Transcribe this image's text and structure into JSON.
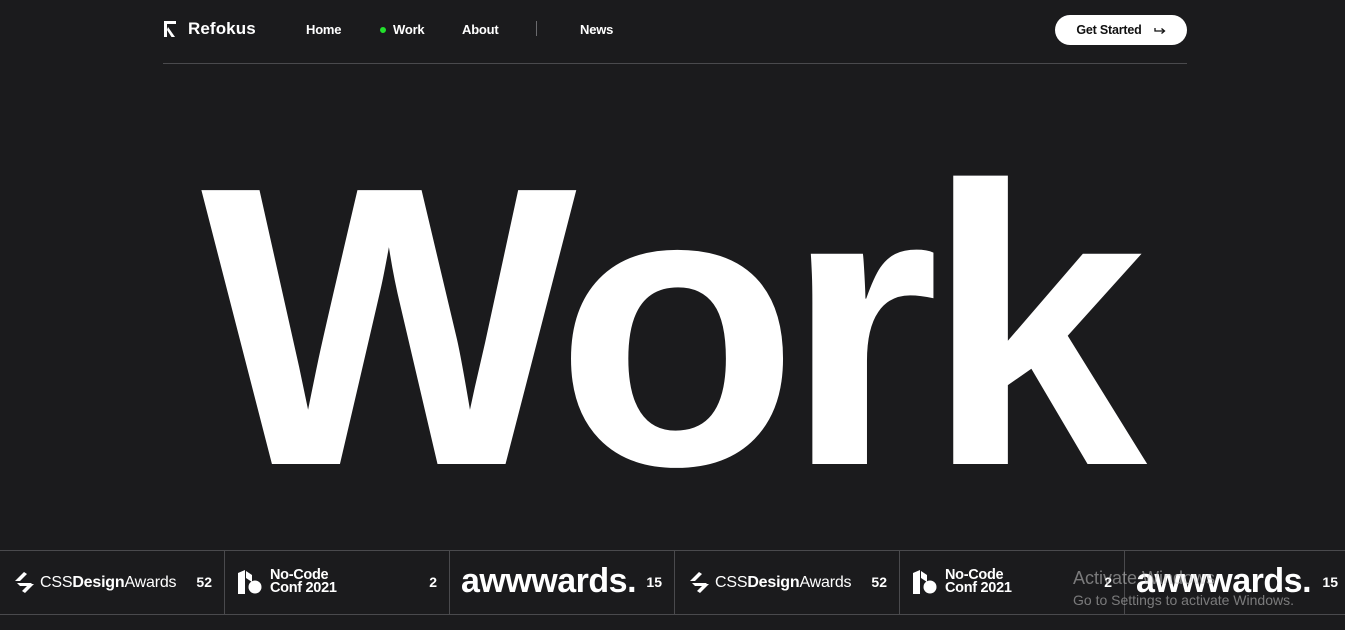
{
  "brand": {
    "name": "Refokus",
    "logo_icon": "refokus-logo-icon"
  },
  "nav": {
    "home": "Home",
    "work": "Work",
    "about": "About",
    "news": "News",
    "active_color": "#22e02c"
  },
  "cta": {
    "label": "Get Started",
    "icon": "arrow-right-icon"
  },
  "hero": {
    "title": "Work"
  },
  "awards": [
    {
      "type": "css",
      "pre": "CSS",
      "bold": "Design",
      "post": "Awards",
      "count": "52"
    },
    {
      "type": "nocode",
      "line1": "No-Code",
      "line2": "Conf 2021",
      "count": "2"
    },
    {
      "type": "awwwards",
      "label": "awwwards.",
      "count": "15"
    },
    {
      "type": "css",
      "pre": "CSS",
      "bold": "Design",
      "post": "Awards",
      "count": "52"
    },
    {
      "type": "nocode",
      "line1": "No-Code",
      "line2": "Conf 2021",
      "count": "2"
    },
    {
      "type": "awwwards",
      "label": "awwwards.",
      "count": "15"
    }
  ],
  "watermark": {
    "title": "Activate Windows",
    "subtitle": "Go to Settings to activate Windows."
  },
  "colors": {
    "background": "#1b1b1d",
    "text": "#ffffff",
    "divider": "#4a4a4d"
  }
}
